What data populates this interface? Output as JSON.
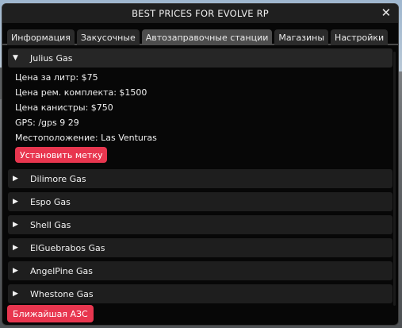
{
  "window": {
    "title": "BEST PRICES FOR EVOLVE RP",
    "close_glyph": "✕"
  },
  "tabs": [
    {
      "label": "Информация"
    },
    {
      "label": "Закусочные"
    },
    {
      "label": "Автозаправочные станции"
    },
    {
      "label": "Магазины"
    },
    {
      "label": "Настройки"
    }
  ],
  "active_tab_index": 2,
  "stations": [
    {
      "name": "Julius Gas",
      "expanded": true,
      "details": [
        "Цена за литр: $75",
        "Цена рем. комплекта: $1500",
        "Цена канистры: $750",
        "GPS: /gps 9 29",
        "Местоположение: Las Venturas"
      ],
      "button": "Установить метку"
    },
    {
      "name": "Dilimore Gas",
      "expanded": false
    },
    {
      "name": "Espo Gas",
      "expanded": false
    },
    {
      "name": "Shell Gas",
      "expanded": false
    },
    {
      "name": "ElGuebrabos Gas",
      "expanded": false
    },
    {
      "name": "AngelPine Gas",
      "expanded": false
    },
    {
      "name": "Whestone Gas",
      "expanded": false
    }
  ],
  "glyphs": {
    "expanded": "▼",
    "collapsed": "▶"
  },
  "nearest_button": "Ближайшая АЗС",
  "colors": {
    "accent": "#e8364f",
    "window_bg": "#070707",
    "active_tab": "#4d4d4d"
  }
}
